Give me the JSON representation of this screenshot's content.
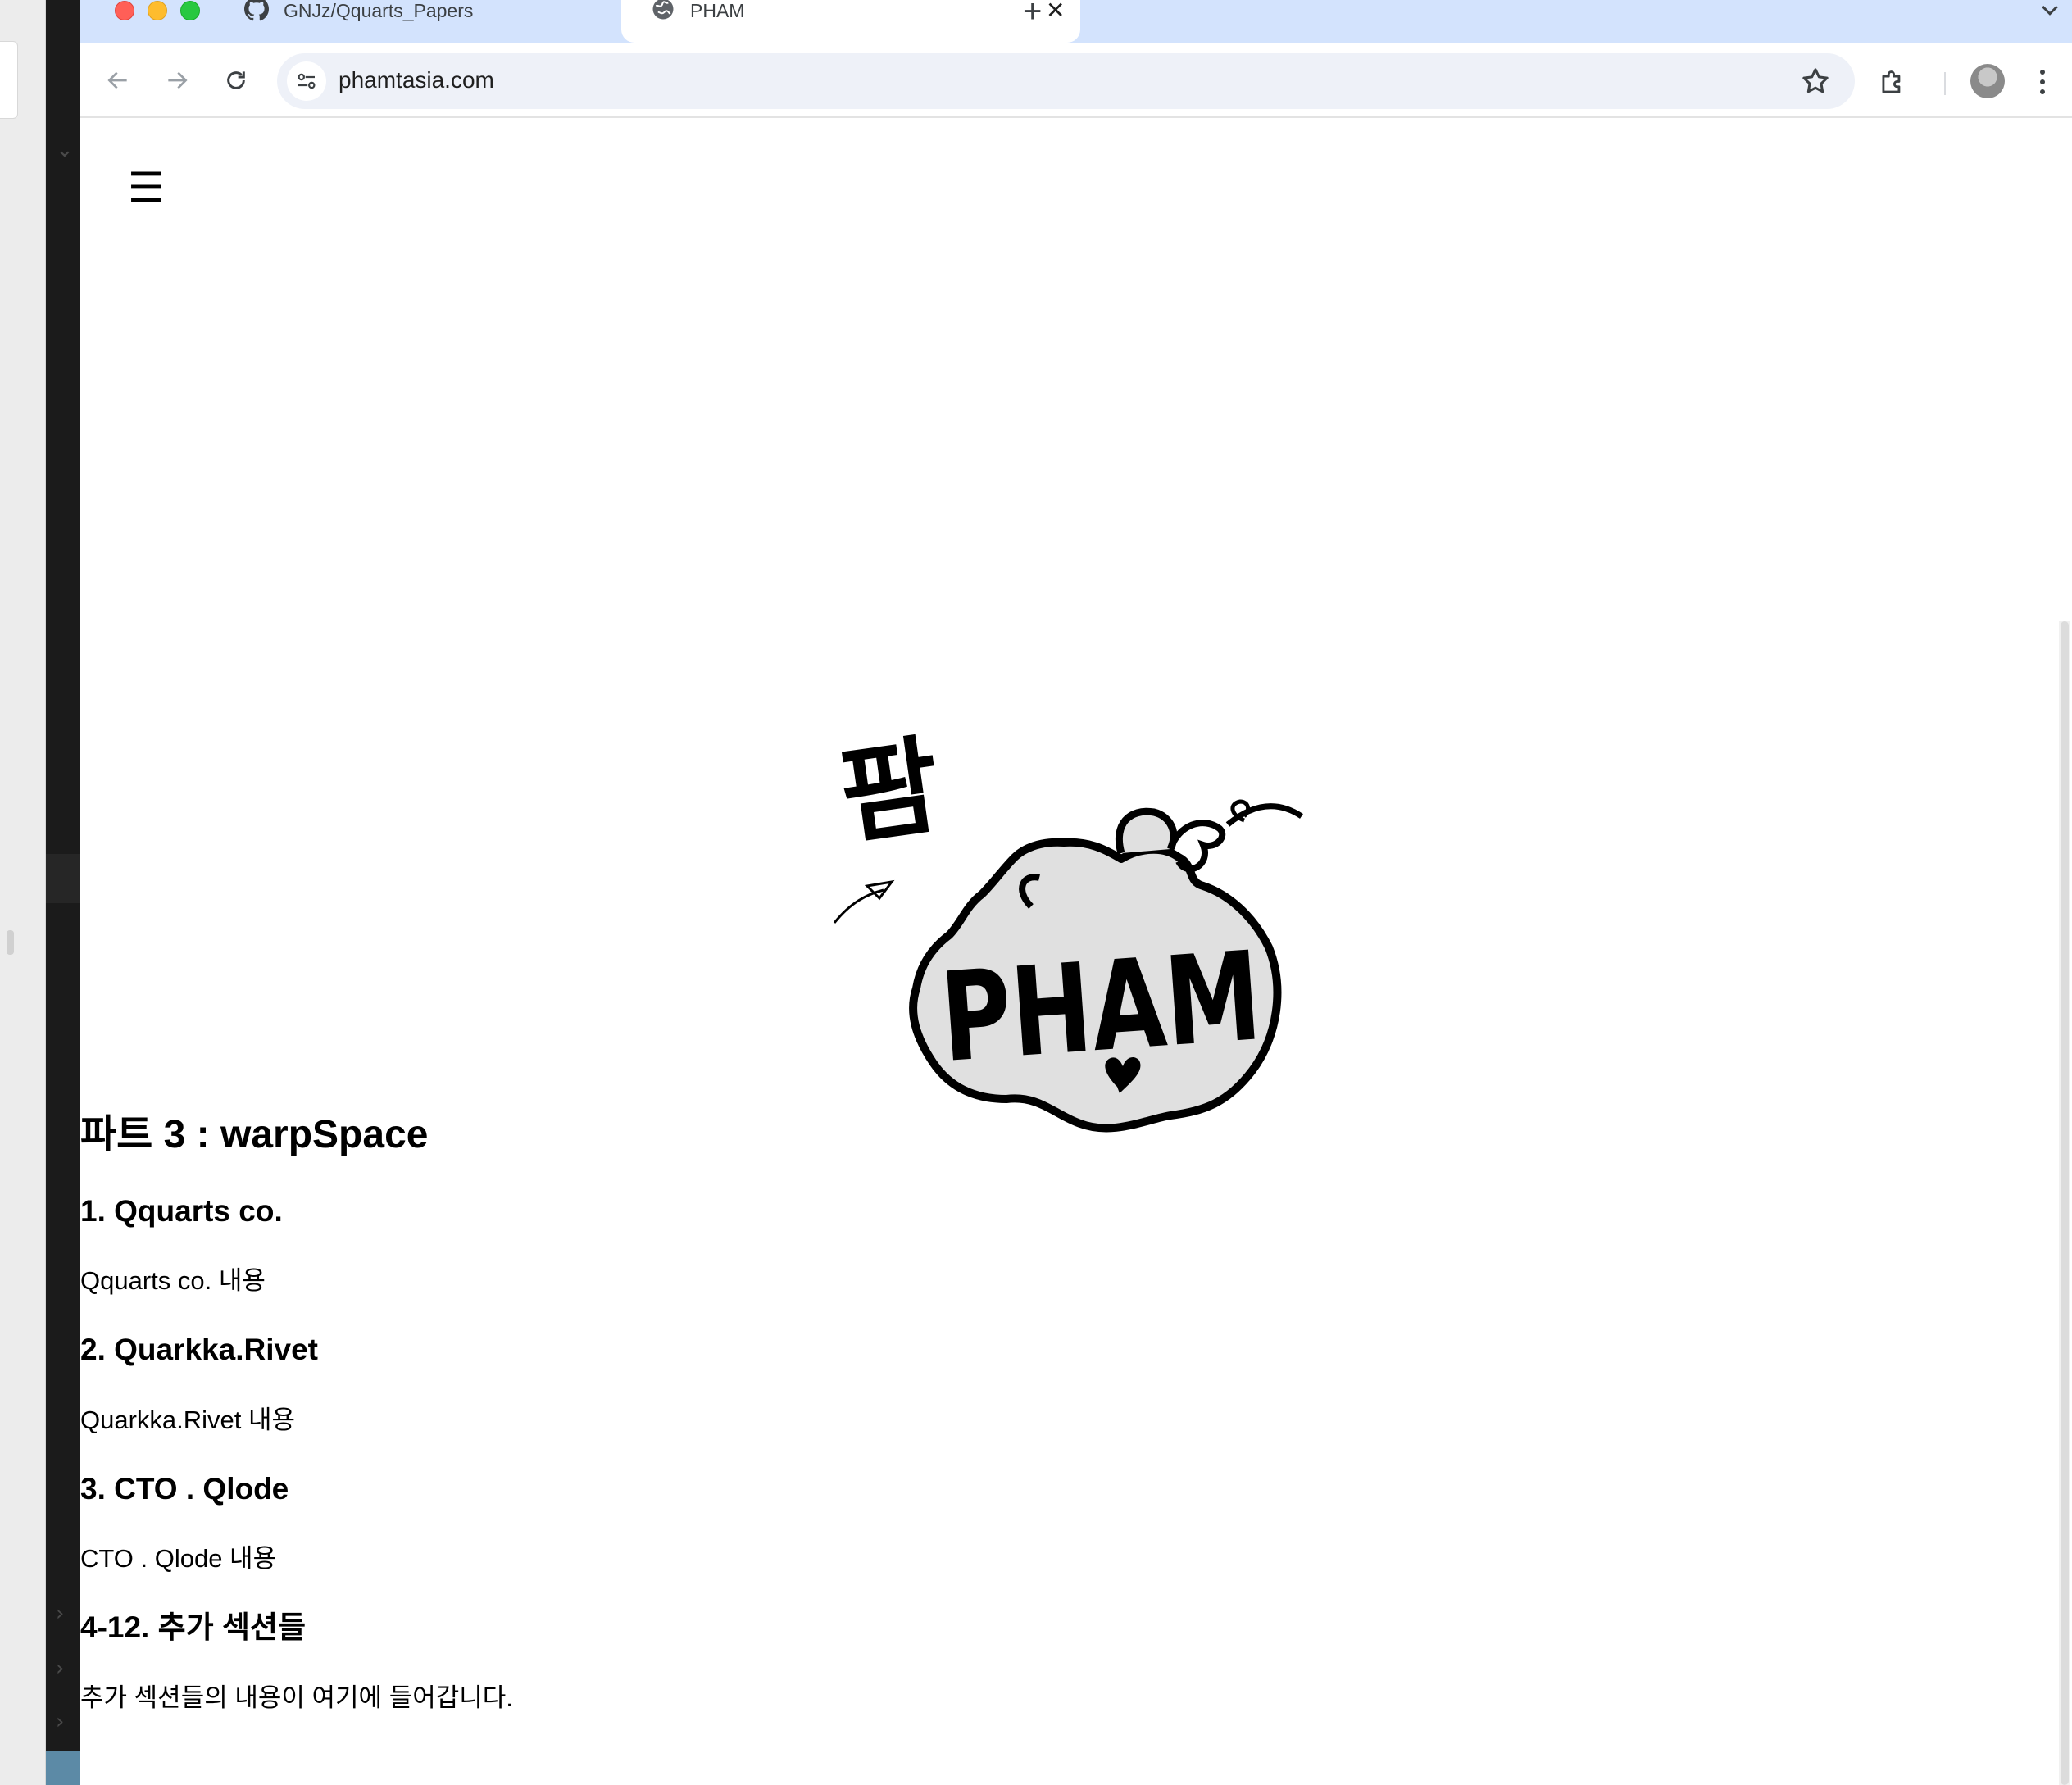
{
  "browser": {
    "tabs": [
      {
        "title": "GNJz/Qquarts_Papers",
        "icon": "github-icon",
        "active": false
      },
      {
        "title": "PHAM",
        "icon": "globe-icon",
        "active": true
      }
    ],
    "new_tab_symbol": "+",
    "tab_close_symbol": "✕",
    "address": "phamtasia.com"
  },
  "page": {
    "menu_icon": "hamburger-icon",
    "logo": {
      "icon": "pham-logo",
      "korean_text": "팜",
      "latin_text": "PHAM"
    },
    "part_title": "파트 3 : warpSpace",
    "sections": [
      {
        "heading": "1. Qquarts co.",
        "body": "Qquarts co. 내용"
      },
      {
        "heading": "2. Quarkka.Rivet",
        "body": "Quarkka.Rivet 내용"
      },
      {
        "heading": "3. CTO . Qlode",
        "body": "CTO . Qlode 내용"
      },
      {
        "heading": "4-12. 추가 섹션들",
        "body": "추가 섹션들의 내용이 여기에 들어갑니다."
      }
    ]
  },
  "colors": {
    "tabstrip": "#d3e3fd",
    "omnibox": "#eef1f8",
    "logo_fill": "#e0e0e0"
  }
}
